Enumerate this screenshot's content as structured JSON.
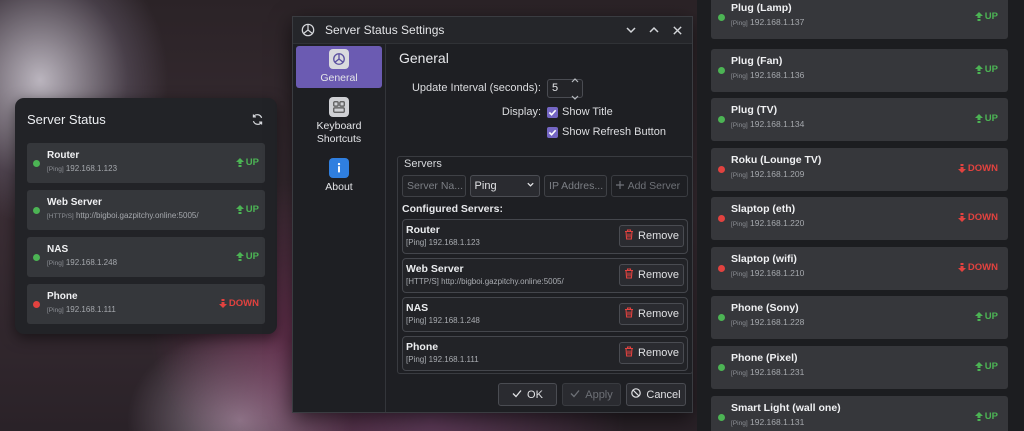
{
  "widget": {
    "title": "Server Status",
    "rows": [
      {
        "name": "Router",
        "tag": "[Ping]",
        "address": "192.168.1.123",
        "status": "UP"
      },
      {
        "name": "Web Server",
        "tag": "[HTTP/S]",
        "address": "http://bigboi.gazpitchy.online:5005/",
        "status": "UP"
      },
      {
        "name": "NAS",
        "tag": "[Ping]",
        "address": "192.168.1.248",
        "status": "UP"
      },
      {
        "name": "Phone",
        "tag": "[Ping]",
        "address": "192.168.1.111",
        "status": "DOWN"
      }
    ]
  },
  "dialog": {
    "title": "Server Status Settings",
    "nav": [
      {
        "label": "General"
      },
      {
        "label": "Keyboard Shortcuts"
      },
      {
        "label": "About"
      }
    ],
    "section_title": "General",
    "update_interval_label": "Update Interval (seconds):",
    "update_interval_value": "5",
    "display_label": "Display:",
    "show_title_label": "Show Title",
    "show_refresh_label": "Show Refresh Button",
    "servers_group_title": "Servers",
    "server_name_placeholder": "Server Na...",
    "type_select_value": "Ping",
    "ip_placeholder": "IP Addres...",
    "add_server_label": "Add Server",
    "configured_label": "Configured Servers:",
    "configured": [
      {
        "name": "Router",
        "detail": "[Ping] 192.168.1.123"
      },
      {
        "name": "Web Server",
        "detail": "[HTTP/S] http://bigboi.gazpitchy.online:5005/"
      },
      {
        "name": "NAS",
        "detail": "[Ping] 192.168.1.248"
      },
      {
        "name": "Phone",
        "detail": "[Ping] 192.168.1.111"
      }
    ],
    "remove_label": "Remove",
    "ok_label": "OK",
    "apply_label": "Apply",
    "cancel_label": "Cancel"
  },
  "right_panel": {
    "rows": [
      {
        "name": "Plug (Lamp)",
        "tag": "[Ping]",
        "address": "192.168.1.137",
        "status": "UP"
      },
      {
        "name": "Plug (Fan)",
        "tag": "[Ping]",
        "address": "192.168.1.136",
        "status": "UP"
      },
      {
        "name": "Plug (TV)",
        "tag": "[Ping]",
        "address": "192.168.1.134",
        "status": "UP"
      },
      {
        "name": "Roku (Lounge TV)",
        "tag": "[Ping]",
        "address": "192.168.1.209",
        "status": "DOWN"
      },
      {
        "name": "Slaptop (eth)",
        "tag": "[Ping]",
        "address": "192.168.1.220",
        "status": "DOWN"
      },
      {
        "name": "Slaptop (wifi)",
        "tag": "[Ping]",
        "address": "192.168.1.210",
        "status": "DOWN"
      },
      {
        "name": "Phone (Sony)",
        "tag": "[Ping]",
        "address": "192.168.1.228",
        "status": "UP"
      },
      {
        "name": "Phone (Pixel)",
        "tag": "[Ping]",
        "address": "192.168.1.231",
        "status": "UP"
      },
      {
        "name": "Smart Light (wall one)",
        "tag": "[Ping]",
        "address": "192.168.1.131",
        "status": "UP"
      }
    ]
  },
  "colors": {
    "up": "#4cb454",
    "down": "#e2423f",
    "accent": "#6b5bb2"
  },
  "icons": {
    "up": "arrow-up-icon",
    "down": "arrow-down-icon",
    "refresh": "refresh-icon",
    "remove": "trash-icon"
  }
}
